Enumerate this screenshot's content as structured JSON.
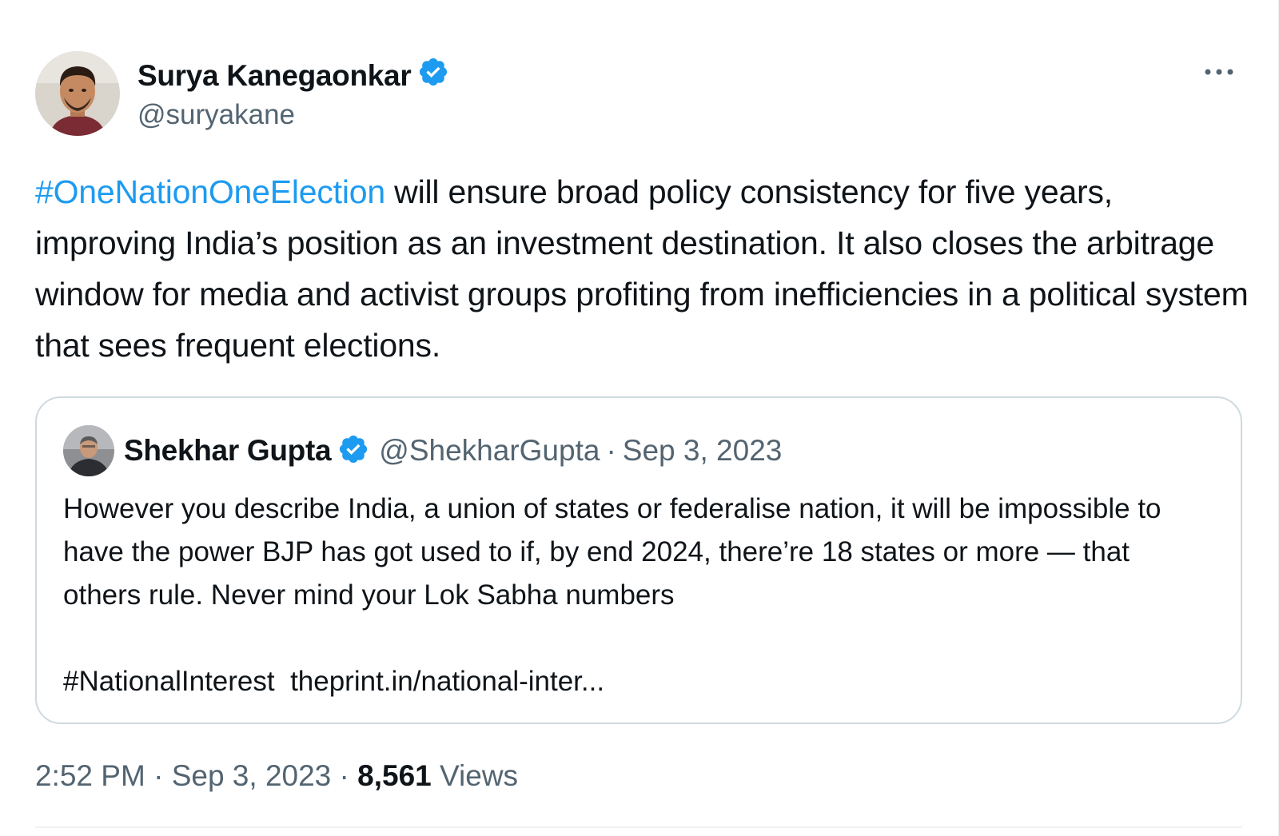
{
  "tweet": {
    "author": {
      "name": "Surya Kanegaonkar",
      "handle": "@suryakane",
      "verified_icon": "verified-badge-icon",
      "avatar_icon": "profile-photo"
    },
    "more_icon": "more-options-icon",
    "text": {
      "hashtag": "#OneNationOneElection",
      "body": " will ensure broad policy consistency for five years, improving India’s position as an investment destination. It also closes the arbitrage window for media and activist groups profiting from inefficiencies in a political system that sees frequent elections."
    },
    "quoted": {
      "name": "Shekhar Gupta",
      "handle": "@ShekharGupta",
      "separator": "·",
      "date": "Sep 3, 2023",
      "text": "However you describe India, a union of states or federalise nation, it will be impossible to have the power BJP has got used to if, by end 2024, there’re 18 states or more — that others rule. Never mind your Lok Sabha numbers",
      "hashtag": "#NationalInterest",
      "link": "theprint.in/national-inter..."
    },
    "meta": {
      "time": "2:52 PM",
      "date": "Sep 3, 2023",
      "separator": "·",
      "views_count": "8,561",
      "views_label": "Views"
    },
    "colors": {
      "accent": "#1d9bf0",
      "text": "#0f1419",
      "secondary": "#536471",
      "border": "#cfd9de"
    }
  }
}
